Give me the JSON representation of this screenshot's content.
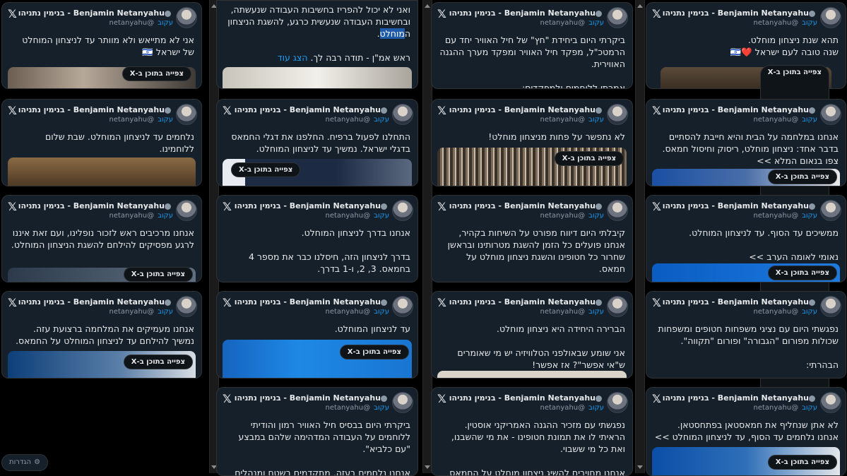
{
  "author": {
    "name": "Benjamin Netanyahu - בנימין נתניהו",
    "handle_he": "עקוב",
    "handle_en": "@netanyahu"
  },
  "watch_label": "צפייה בתוכן ב-X",
  "more_label": "הצג עוד",
  "settings_label": "הגדרות",
  "cards": [
    {
      "text": "תהא שנת ניצחון מוחלט.\nשנה טובה לעם ישראל ❤️🇮🇱"
    },
    {
      "text": "ביקרתי היום ביחידת \"חץ\" של חיל האוויר יחד עם הרמטכ\"ל, מפקד חיל האוויר ומפקד מערך ההגנה האווירית.\n\nאמרתי ללוחמים ולמפקדים:"
    },
    {
      "text_a": "ואני לא יכול להפריז בחשיבות העבודה שנעשתה, ובחשיבות העבודה שנעשית כרגע, להשגת הניצחון ה",
      "text_hl": "מוחלט",
      "text_b": ".\n\nראש אמ\"ן - תודה רבה לך. "
    },
    {
      "text": "אני לא מתייאש ולא מוותר עד לניצחון המוחלט של ישראל 🇮🇱"
    },
    {
      "text": "אנחנו במלחמה על הבית והיא חייבת להסתיים בדבר אחד: ניצחון מוחלט, ריסוק וחיסול חמאס.\nצפו בנאום המלא >>"
    },
    {
      "text": "לא נתפשר על פחות מניצחון מוחלט!"
    },
    {
      "text": "התחלנו לפעול ברפיח. החלפנו את דגלי החמאס בדגלי ישראל. נמשיך עד לניצחון המוחלט."
    },
    {
      "text": "נלחמים עד לניצחון המוחלט. שבת שלום ללוחמינו."
    },
    {
      "text": "ממשיכים עד הסוף. עד לניצחון המוחלט.\n\nנאומי לאומה הערב >>"
    },
    {
      "text": "קיבלתי היום דיווח מפורט על השיחות בקהיר, אנחנו פועלים כל הזמן להשגת מטרותינו ובראשן שחרור כל חטופינו והשגת ניצחון מוחלט על חמאס."
    },
    {
      "text": "אנחנו בדרך לניצחון המוחלט.\n\nבדרך לניצחון הזה, חיסלנו כבר את מספר 4 בחמאס. 3, 2, ו-1 בדרך."
    },
    {
      "text": "אנחנו מרכיבים ראש לזכור נופלינו, ועם זאת איננו לרגע מפסיקים להילחם להשגת הניצחון המוחלט."
    },
    {
      "text": "נפגשתי היום עם נציגי משפחות חטופים ומשפחות שכולות מפורום \"הגבורה\" ופורום \"תקווה\".\n\nהבהרתי:"
    },
    {
      "text": "הברירה היחידה היא ניצחון מוחלט.\n\nאני שומע שבאולפני הטלוויזיה יש מי שאומרים ש\"אי אפשר\"? אז אפשר!"
    },
    {
      "text": "עד לניצחון המוחלט."
    },
    {
      "text": "אנחנו מעמיקים את המלחמה ברצועת עזה. נמשיך להילחם עד לניצחון המוחלט על החמאס."
    },
    {
      "text": "לא אתן שנחליף את חמאסטאן בפתחסטאן. אנחנו נלחמים עד הסוף, עד לניצחון המוחלט >>"
    },
    {
      "text": "נפגשתי עם מזכיר ההגנה האמריקני אוסטין. הראיתי לו את תמונת חטופינו - את מי שהשבנו, ואת כל מי ששבוי.\n\nאנחנו מחויבים להשיג ניצחון מוחלט על החמאס"
    },
    {
      "text": "ביקרתי היום בבסיס חיל האוויר רמון והודיתי ללוחמים על העבודה המדהימה שלהם במבצע \"עם כלביא\".\n\nאנחנו נלחמים בעזה, מתקדמים בשטח ומנהלים"
    }
  ]
}
